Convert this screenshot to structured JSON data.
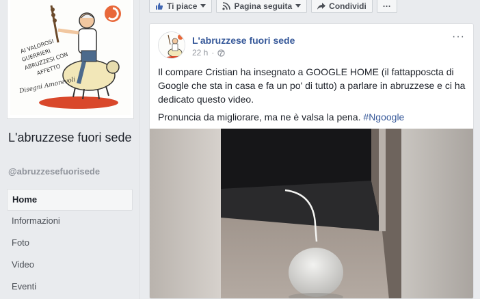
{
  "page": {
    "name": "L'abruzzese fuori sede",
    "handle": "@abruzzesefuorisede",
    "cover_caption": "AI VALOROSI GUERRIERI ABRUZZESI CON AFFETTO",
    "cover_signature": "Disegni Amorevoli"
  },
  "nav": {
    "items": [
      {
        "label": "Home",
        "active": true
      },
      {
        "label": "Informazioni",
        "active": false
      },
      {
        "label": "Foto",
        "active": false
      },
      {
        "label": "Video",
        "active": false
      },
      {
        "label": "Eventi",
        "active": false
      }
    ]
  },
  "actions": {
    "like_label": "Ti piace",
    "follow_label": "Pagina seguita",
    "share_label": "Condividi",
    "more_label": "···"
  },
  "post": {
    "author": "L'abruzzese fuori sede",
    "time": "22 h",
    "privacy_icon": "globe-icon",
    "menu_label": "···",
    "paragraph1": "Il compare Cristian ha insegnato a GOOGLE HOME (il fattapposcta di Google che sta in casa e fa un po' di tutto) a parlare in abruzzese e ci ha dedicato questo video.",
    "paragraph2_text": "Pronuncia da migliorare, ma ne è valsa la pena. ",
    "hashtag": "#Ngoogle"
  },
  "colors": {
    "link": "#365899",
    "background": "#e9ebee",
    "card": "#ffffff",
    "muted": "#90949c"
  }
}
